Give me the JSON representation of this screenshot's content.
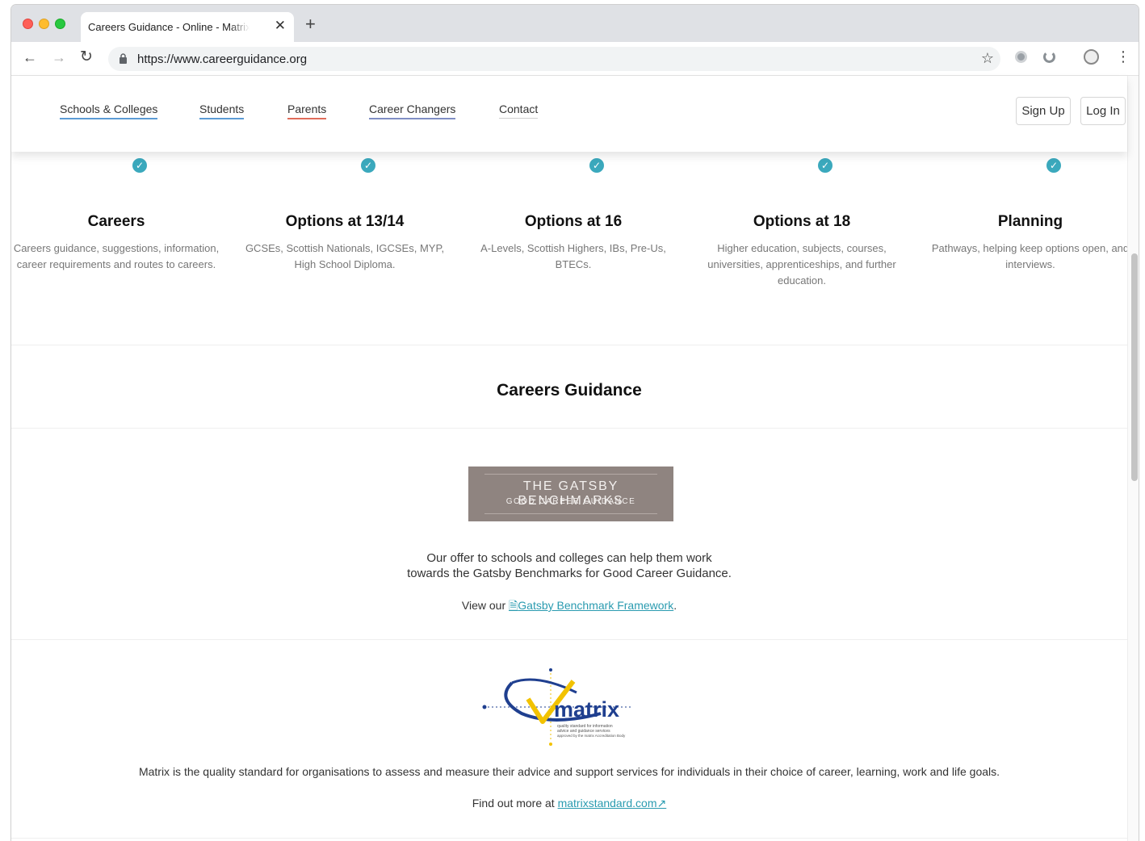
{
  "browser": {
    "tab_title": "Careers Guidance - Online - Matrix",
    "tab_close": "✕",
    "new_tab": "+",
    "url": "https://www.careerguidance.org",
    "icons": [
      "back-icon",
      "forward-icon",
      "reload-icon",
      "lock-icon",
      "star-icon",
      "extension-icon",
      "profile-icon",
      "menu-icon"
    ]
  },
  "nav": {
    "items": [
      {
        "label": "Schools & Colleges",
        "color": "#5b9bd5"
      },
      {
        "label": "Students",
        "color": "#5b9bd5"
      },
      {
        "label": "Parents",
        "color": "#e06c5a"
      },
      {
        "label": "Career Changers",
        "color": "#7f8ec4"
      },
      {
        "label": "Contact",
        "color": "#cfcfcf"
      }
    ],
    "signup": "Sign Up",
    "login": "Log In"
  },
  "features": [
    {
      "title": "Careers",
      "desc": "Careers guidance, suggestions, information, career requirements and routes to careers."
    },
    {
      "title": "Options at 13/14",
      "desc": "GCSEs, Scottish Nationals, IGCSEs, MYP, High School Diploma."
    },
    {
      "title": "Options at 16",
      "desc": "A-Levels, Scottish Highers, IBs, Pre-Us, BTECs."
    },
    {
      "title": "Options at 18",
      "desc": "Higher education, subjects, courses, universities, apprenticeships, and further education."
    },
    {
      "title": "Planning",
      "desc": "Pathways, helping keep options open, and interviews."
    }
  ],
  "guidance": {
    "title": "Careers Guidance",
    "gatsby_logo": {
      "line1": "THE GATSBY BENCHMARKS",
      "line2": "GOOD CAREER GUIDANCE"
    },
    "offer_line1": "Our offer to schools and colleges can help them work",
    "offer_line2": "towards the Gatsby Benchmarks for Good Career Guidance.",
    "view_prefix": "View our ",
    "view_link": "Gatsby Benchmark Framework",
    "view_suffix": ".",
    "matrix_logo": {
      "word": "matrix",
      "tag1": "quality standard for information",
      "tag2": "advice and guidance services",
      "tag3": "approved by the matrix Accreditation Body"
    },
    "matrix_desc": "Matrix is the quality standard for organisations to assess and measure their advice and support services for individuals in their choice of career, learning, work and life goals.",
    "find_prefix": "Find out more at ",
    "find_link": "matrixstandard.com"
  },
  "colors": {
    "accent": "#3ba9bd",
    "link": "#2a9bb0",
    "gatsby_bg": "#8f8480",
    "matrix_blue": "#1f3f8f",
    "matrix_yellow": "#f2c200"
  }
}
